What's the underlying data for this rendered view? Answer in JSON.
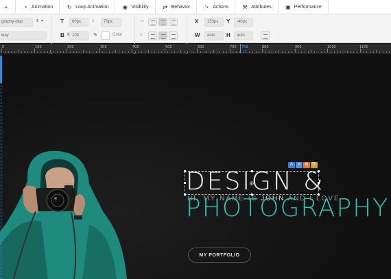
{
  "tabs": [
    {
      "name": "tab-add",
      "icon": "+",
      "label": ""
    },
    {
      "name": "tab-animation",
      "icon": "◔",
      "label": "Animation"
    },
    {
      "name": "tab-loop-animation",
      "icon": "↻",
      "label": "Loop Animation"
    },
    {
      "name": "tab-visibility",
      "icon": "◉",
      "label": "Visibility"
    },
    {
      "name": "tab-behavior",
      "icon": "⇄",
      "label": "Behavior"
    },
    {
      "name": "tab-actions",
      "icon": "⤷",
      "label": "Actions"
    },
    {
      "name": "tab-attributes",
      "icon": "⚒",
      "label": "Attributes"
    },
    {
      "name": "tab-performance",
      "icon": "▣",
      "label": "Performance"
    }
  ],
  "props": {
    "font_class": "graphy-disp",
    "font_weight_hint": "way",
    "font_size": "80px",
    "line_height": "70px",
    "letter_spacing": "100",
    "color_label": "Color",
    "x_label": "X",
    "x_value": "153px",
    "y_label": "Y",
    "y_value": "-40px",
    "w_label": "W",
    "w_value": "auto",
    "h_label": "H",
    "h_value": "auto",
    "t_label": "T",
    "b_label": "B"
  },
  "ruler": {
    "labels": [
      "0",
      "100",
      "200",
      "300",
      "400",
      "500",
      "600",
      "700",
      "758",
      "800",
      "900",
      "1000",
      "1100"
    ]
  },
  "canvas": {
    "intro_prefix": "HI, MY NAME IS ",
    "intro_name": "JOHN",
    "intro_suffix": " AND I LOVE",
    "headline_line1": "DESIGN &",
    "headline_line2": "PHOTOGRAPHY",
    "portfolio_button": "MY PORTFOLIO",
    "chip_labels": [
      "A",
      "≡",
      "⚙",
      "⎘"
    ],
    "chip_colors": [
      "#3b7dd8",
      "#4a90e2",
      "#e07a2f",
      "#c9a227"
    ]
  },
  "colors": {
    "accent": "#2ec4b6",
    "guide": "#3aa3ff"
  }
}
